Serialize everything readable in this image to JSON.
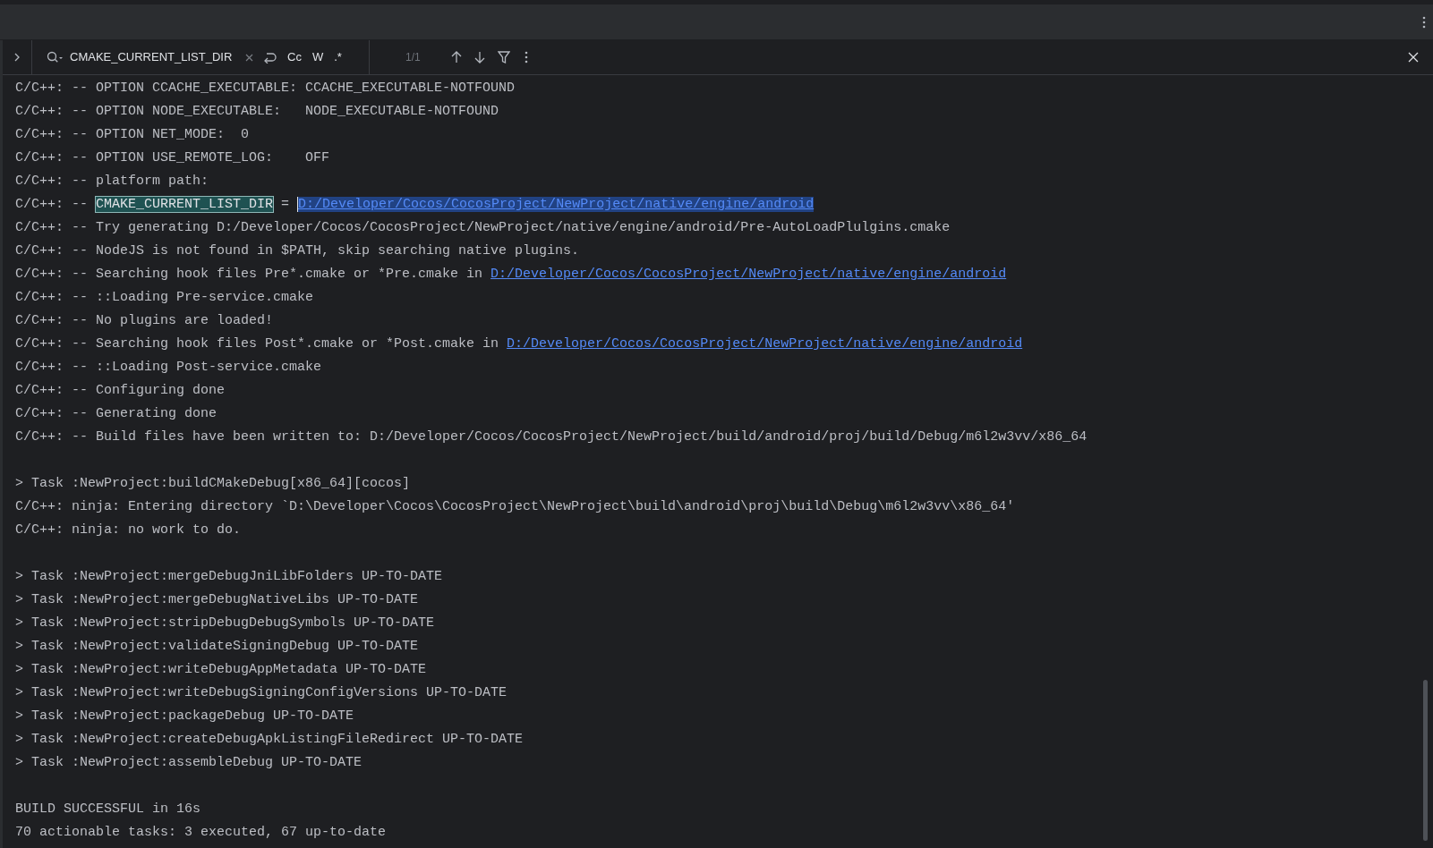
{
  "search": {
    "value": "CMAKE_CURRENT_LIST_DIR",
    "options": [
      {
        "label": "Cc",
        "selected": false
      },
      {
        "label": "W",
        "selected": false
      },
      {
        "label": ".*",
        "selected": false
      }
    ],
    "count": "1/1"
  },
  "console": {
    "blocks": [
      {
        "lines": [
          {
            "segments": [
              {
                "kind": "text",
                "text": "C/C++: -- OPTION CCACHE_EXECUTABLE: CCACHE_EXECUTABLE-NOTFOUND"
              }
            ]
          },
          {
            "segments": [
              {
                "kind": "text",
                "text": "C/C++: -- OPTION NODE_EXECUTABLE:   NODE_EXECUTABLE-NOTFOUND"
              }
            ]
          },
          {
            "segments": [
              {
                "kind": "text",
                "text": "C/C++: -- OPTION NET_MODE:  0"
              }
            ]
          },
          {
            "segments": [
              {
                "kind": "text",
                "text": "C/C++: -- OPTION USE_REMOTE_LOG:    OFF"
              }
            ]
          },
          {
            "segments": [
              {
                "kind": "text",
                "text": "C/C++: -- platform path:"
              }
            ]
          },
          {
            "segments": [
              {
                "kind": "text",
                "text": "C/C++: -- "
              },
              {
                "kind": "match",
                "text": "CMAKE_CURRENT_LIST_DIR"
              },
              {
                "kind": "text",
                "text": " = "
              },
              {
                "kind": "selected-link",
                "text": "D:/Developer/Cocos/CocosProject/NewProject/native/engine/android"
              }
            ]
          },
          {
            "segments": [
              {
                "kind": "text",
                "text": "C/C++: -- Try generating D:/Developer/Cocos/CocosProject/NewProject/native/engine/android/Pre-AutoLoadPlulgins.cmake"
              }
            ]
          },
          {
            "segments": [
              {
                "kind": "text",
                "text": "C/C++: -- NodeJS is not found in $PATH, skip searching native plugins."
              }
            ]
          },
          {
            "segments": [
              {
                "kind": "text",
                "text": "C/C++: -- Searching hook files Pre*.cmake or *Pre.cmake in "
              },
              {
                "kind": "link",
                "text": "D:/Developer/Cocos/CocosProject/NewProject/native/engine/android"
              }
            ]
          },
          {
            "segments": [
              {
                "kind": "text",
                "text": "C/C++: -- ::Loading Pre-service.cmake"
              }
            ]
          },
          {
            "segments": [
              {
                "kind": "text",
                "text": "C/C++: -- No plugins are loaded!"
              }
            ]
          },
          {
            "segments": [
              {
                "kind": "text",
                "text": "C/C++: -- Searching hook files Post*.cmake or *Post.cmake in "
              },
              {
                "kind": "link",
                "text": "D:/Developer/Cocos/CocosProject/NewProject/native/engine/android"
              }
            ]
          },
          {
            "segments": [
              {
                "kind": "text",
                "text": "C/C++: -- ::Loading Post-service.cmake"
              }
            ]
          },
          {
            "segments": [
              {
                "kind": "text",
                "text": "C/C++: -- Configuring done"
              }
            ]
          },
          {
            "segments": [
              {
                "kind": "text",
                "text": "C/C++: -- Generating done"
              }
            ]
          },
          {
            "segments": [
              {
                "kind": "text",
                "text": "C/C++: -- Build files have been written to: D:/Developer/Cocos/CocosProject/NewProject/build/android/proj/build/Debug/m6l2w3vv/x86_64"
              }
            ]
          }
        ]
      },
      {
        "lines": [
          {
            "segments": [
              {
                "kind": "text",
                "text": "> Task :NewProject:buildCMakeDebug[x86_64][cocos]"
              }
            ]
          },
          {
            "segments": [
              {
                "kind": "text",
                "text": "C/C++: ninja: Entering directory `D:\\Developer\\Cocos\\CocosProject\\NewProject\\build\\android\\proj\\build\\Debug\\m6l2w3vv\\x86_64'"
              }
            ]
          },
          {
            "segments": [
              {
                "kind": "text",
                "text": "C/C++: ninja: no work to do."
              }
            ]
          }
        ]
      },
      {
        "lines": [
          {
            "segments": [
              {
                "kind": "text",
                "text": "> Task :NewProject:mergeDebugJniLibFolders UP-TO-DATE"
              }
            ]
          },
          {
            "segments": [
              {
                "kind": "text",
                "text": "> Task :NewProject:mergeDebugNativeLibs UP-TO-DATE"
              }
            ]
          },
          {
            "segments": [
              {
                "kind": "text",
                "text": "> Task :NewProject:stripDebugDebugSymbols UP-TO-DATE"
              }
            ]
          },
          {
            "segments": [
              {
                "kind": "text",
                "text": "> Task :NewProject:validateSigningDebug UP-TO-DATE"
              }
            ]
          },
          {
            "segments": [
              {
                "kind": "text",
                "text": "> Task :NewProject:writeDebugAppMetadata UP-TO-DATE"
              }
            ]
          },
          {
            "segments": [
              {
                "kind": "text",
                "text": "> Task :NewProject:writeDebugSigningConfigVersions UP-TO-DATE"
              }
            ]
          },
          {
            "segments": [
              {
                "kind": "text",
                "text": "> Task :NewProject:packageDebug UP-TO-DATE"
              }
            ]
          },
          {
            "segments": [
              {
                "kind": "text",
                "text": "> Task :NewProject:createDebugApkListingFileRedirect UP-TO-DATE"
              }
            ]
          },
          {
            "segments": [
              {
                "kind": "text",
                "text": "> Task :NewProject:assembleDebug UP-TO-DATE"
              }
            ]
          }
        ]
      },
      {
        "lines": [
          {
            "segments": [
              {
                "kind": "text",
                "text": "BUILD SUCCESSFUL in 16s"
              }
            ]
          },
          {
            "segments": [
              {
                "kind": "text",
                "text": "70 actionable tasks: 3 executed, 67 up-to-date"
              }
            ]
          }
        ]
      }
    ]
  }
}
